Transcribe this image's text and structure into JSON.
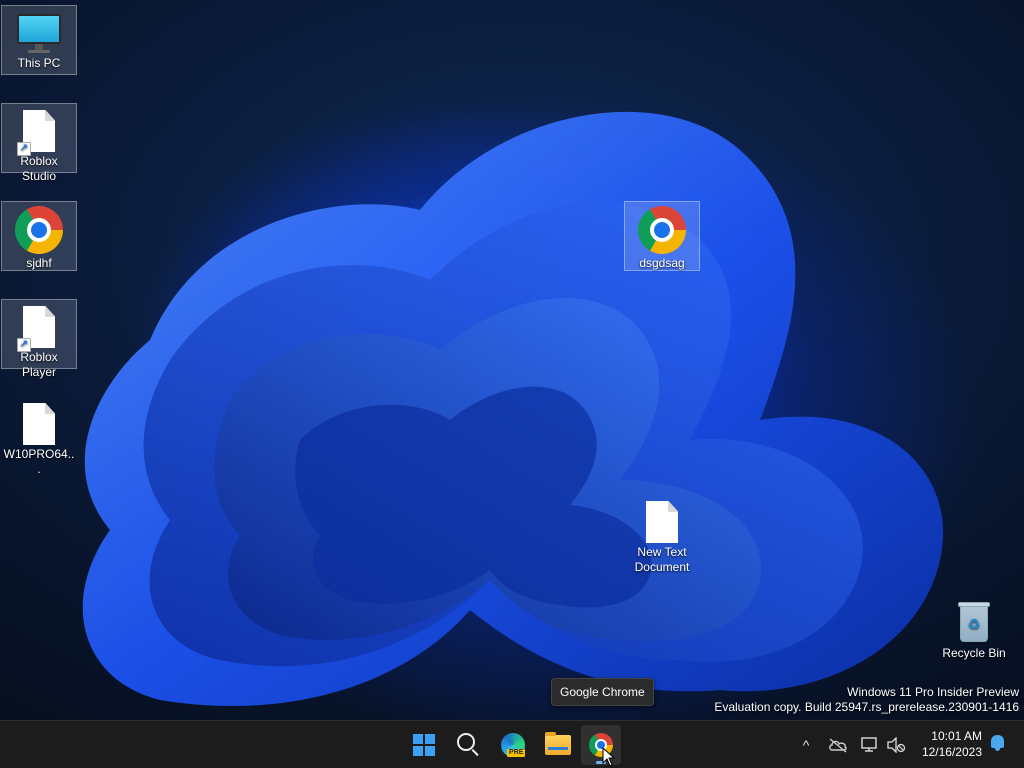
{
  "desktop": {
    "icons": [
      {
        "label": "This PC"
      },
      {
        "label": "Roblox Studio"
      },
      {
        "label": "sjdhf"
      },
      {
        "label": "Roblox Player"
      },
      {
        "label": "W10PRO64..."
      },
      {
        "label": "dsgdsag"
      },
      {
        "label": "New Text Document"
      },
      {
        "label": "Recycle Bin"
      }
    ],
    "watermark": {
      "line1": "Windows 11 Pro Insider Preview",
      "line2": "Evaluation copy. Build 25947.rs_prerelease.230901-1416"
    },
    "tooltip": "Google Chrome"
  },
  "taskbar": {
    "apps": [
      {
        "icon": "windows-start-icon",
        "state": "normal"
      },
      {
        "icon": "search-icon",
        "state": "normal"
      },
      {
        "icon": "edge-preview-icon",
        "badge": "PRE",
        "state": "normal"
      },
      {
        "icon": "file-explorer-icon",
        "state": "normal"
      },
      {
        "icon": "chrome-icon",
        "state": "active"
      }
    ],
    "tray": {
      "overflow": "^",
      "time": "10:01 AM",
      "date": "12/16/2023"
    }
  },
  "colors": {
    "accent": "#3aa0f3",
    "taskbar_bg": "#1c1c1c"
  }
}
